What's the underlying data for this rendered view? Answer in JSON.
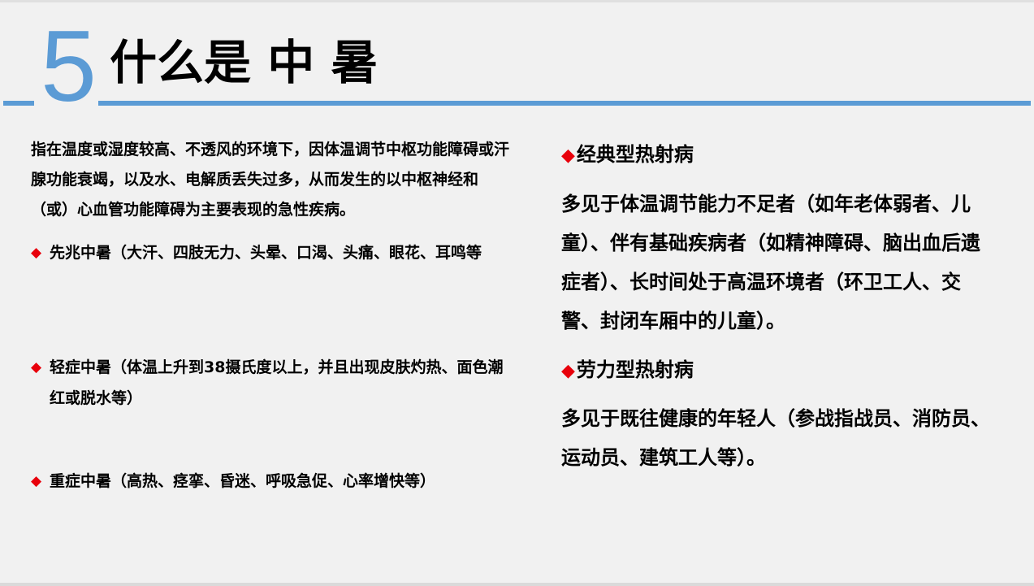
{
  "slide": {
    "number": "5",
    "title": "什么是 中 暑",
    "accent_color": "#5b9bd5",
    "bullet_color": "#e8000b"
  },
  "left": {
    "intro": "指在温度或湿度较高、不透风的环境下，因体温调节中枢功能障碍或汗腺功能衰竭，以及水、电解质丢失过多，从而发生的以中枢神经和（或）心血管功能障碍为主要表现的急性疾病。",
    "bullets": [
      {
        "marker": "◆",
        "text": "先兆中暑（大汗、四肢无力、头晕、口渴、头痛、眼花、耳鸣等"
      },
      {
        "marker": "◆",
        "text": "轻症中暑（体温上升到38摄氏度以上，并且出现皮肤灼热、面色潮红或脱水等）"
      },
      {
        "marker": "◆",
        "text": "重症中暑（高热、痉挛、昏迷、呼吸急促、心率增快等）"
      }
    ]
  },
  "right": {
    "sections": [
      {
        "marker": "◆",
        "heading": "经典型热射病",
        "body": "多见于体温调节能力不足者（如年老体弱者、儿童）、伴有基础疾病者（如精神障碍、脑出血后遗症者）、长时间处于高温环境者（环卫工人、交警、封闭车厢中的儿童）。"
      },
      {
        "marker": "◆",
        "heading": "劳力型热射病",
        "body": "多见于既往健康的年轻人（参战指战员、消防员、运动员、建筑工人等）。"
      }
    ]
  }
}
